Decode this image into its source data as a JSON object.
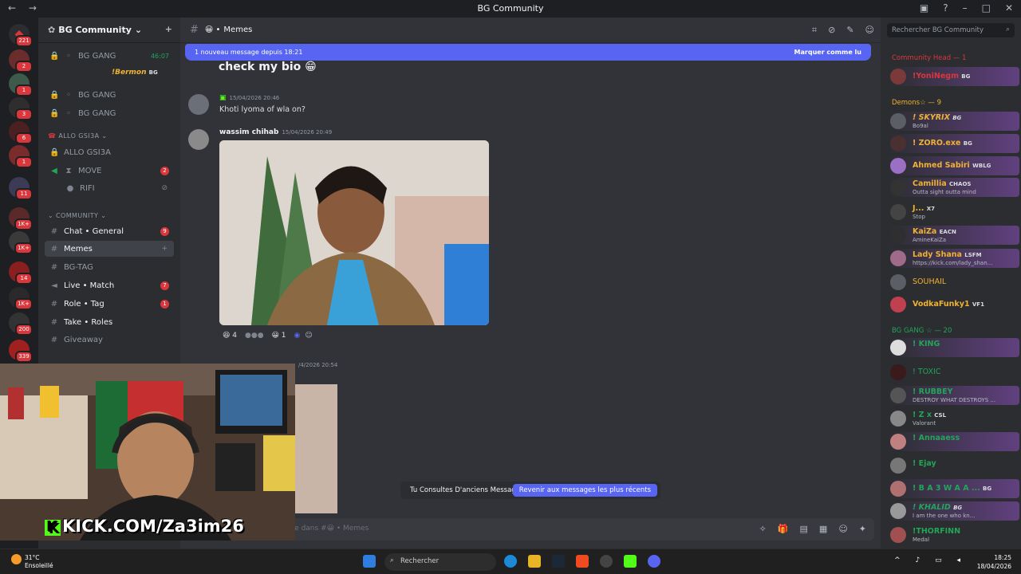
{
  "titlebar": {
    "title": "BG Community"
  },
  "servers": [
    {
      "badge": "221"
    },
    {
      "badge": "2"
    },
    {
      "badge": "1"
    },
    {
      "badge": "3"
    },
    {
      "badge": "6"
    },
    {
      "badge": "1"
    },
    {
      "badge": "11"
    },
    {
      "badge": "1K+"
    },
    {
      "badge": "1K+"
    },
    {
      "badge": "14"
    },
    {
      "badge": "1K+"
    },
    {
      "badge": "200"
    },
    {
      "badge": "339"
    }
  ],
  "guild": {
    "name": "BG Community"
  },
  "channels": [
    {
      "label": "BG GANG",
      "meta": "46:07"
    },
    {
      "label": "!Bermon",
      "tag": "BG"
    },
    {
      "label": "BG GANG"
    },
    {
      "label": "BG GANG"
    },
    {
      "label": "ALLO GSI3A",
      "category": true
    },
    {
      "label": "ALLO GSI3A"
    },
    {
      "label": "MOVE",
      "count": "2"
    },
    {
      "label": "RIFI"
    },
    {
      "label": "COMMUNITY",
      "category": true
    },
    {
      "label": "Chat • General",
      "count": "9"
    },
    {
      "label": "Memes"
    },
    {
      "label": "BG-TAG"
    },
    {
      "label": "Live • Match",
      "count": "7"
    },
    {
      "label": "Role • Tag",
      "count": "1"
    },
    {
      "label": "Take • Roles"
    },
    {
      "label": "Giveaway"
    }
  ],
  "main": {
    "channel_name": "Memes",
    "new_messages": "1 nouveau message depuis 18:21",
    "mark_read": "Marquer comme lu",
    "big_text": "check my bio 😁",
    "messages": [
      {
        "author": "",
        "time": "15/04/2026 20:46",
        "text": "Khoti lyoma of wla on?"
      },
      {
        "author": "wassim chihab",
        "time": "15/04/2026 20:49"
      }
    ],
    "reactions": [
      {
        "emoji": "😆",
        "count": "4"
      },
      {
        "emoji": "😀",
        "count": "1"
      }
    ],
    "partial_time": "/4/2026 20:54",
    "old_messages": "Tu Consultes D'anciens Messages",
    "jump_recent": "Revenir aux messages les plus récents",
    "composer_placeholder": "un message dans #😀 • Memes"
  },
  "stream_overlay": {
    "brand": "KICK.COM/Za3im26"
  },
  "members": {
    "search_placeholder": "Rechercher BG Community",
    "categories": [
      {
        "label": "Community Head — 1"
      },
      {
        "label": "Demons☆ — 9"
      },
      {
        "label": "BG GANG ☆ — 20"
      }
    ],
    "list": [
      {
        "name": "!YoniNegm",
        "tag": "BG",
        "status": ""
      },
      {
        "name": "! SKYRIX",
        "tag": "BG",
        "status": "Bo9al"
      },
      {
        "name": "! ZORO.exe",
        "tag": "BG",
        "status": ""
      },
      {
        "name": "Ahmed Sabiri",
        "tag": "WBLG",
        "status": ""
      },
      {
        "name": "Camillia",
        "tag": "CHAOS",
        "status": "Outta sight outta mind"
      },
      {
        "name": "J...",
        "tag": "X7",
        "status": "Stop"
      },
      {
        "name": "KaiZa",
        "tag": "EACN",
        "status": "AmineKaiZa"
      },
      {
        "name": "Lady Shana",
        "tag": "LSFM",
        "status": "https://kick.com/lady_shan..."
      },
      {
        "name": "SOUHAIL",
        "tag": "",
        "status": ""
      },
      {
        "name": "VodkaFunky1",
        "tag": "VF1",
        "status": ""
      },
      {
        "name": "! KING",
        "tag": "",
        "status": ""
      },
      {
        "name": "! TOXIC",
        "tag": "",
        "status": ""
      },
      {
        "name": "! RUBBEY",
        "tag": "",
        "status": "DESTROY WHAT DESTROYS ..."
      },
      {
        "name": "! Z x",
        "tag": "CSL",
        "status": "Valorant"
      },
      {
        "name": "! Annaaess",
        "tag": "",
        "status": ""
      },
      {
        "name": "! Ejay",
        "tag": "",
        "status": ""
      },
      {
        "name": "! B A 3 W A A ...",
        "tag": "BG",
        "status": ""
      },
      {
        "name": "! KHALID",
        "tag": "BG",
        "status": "I am the one who kn..."
      },
      {
        "name": "!THORFINN",
        "tag": "",
        "status": "Medal"
      }
    ]
  },
  "taskbar": {
    "temp": "31°C",
    "weather": "Ensoleillé",
    "search": "Rechercher",
    "time": "18:25",
    "date": "18/04/2026"
  },
  "colors": {
    "accent": "#5865f2",
    "danger": "#da373c",
    "online": "#23a559",
    "kick": "#53fc18"
  }
}
